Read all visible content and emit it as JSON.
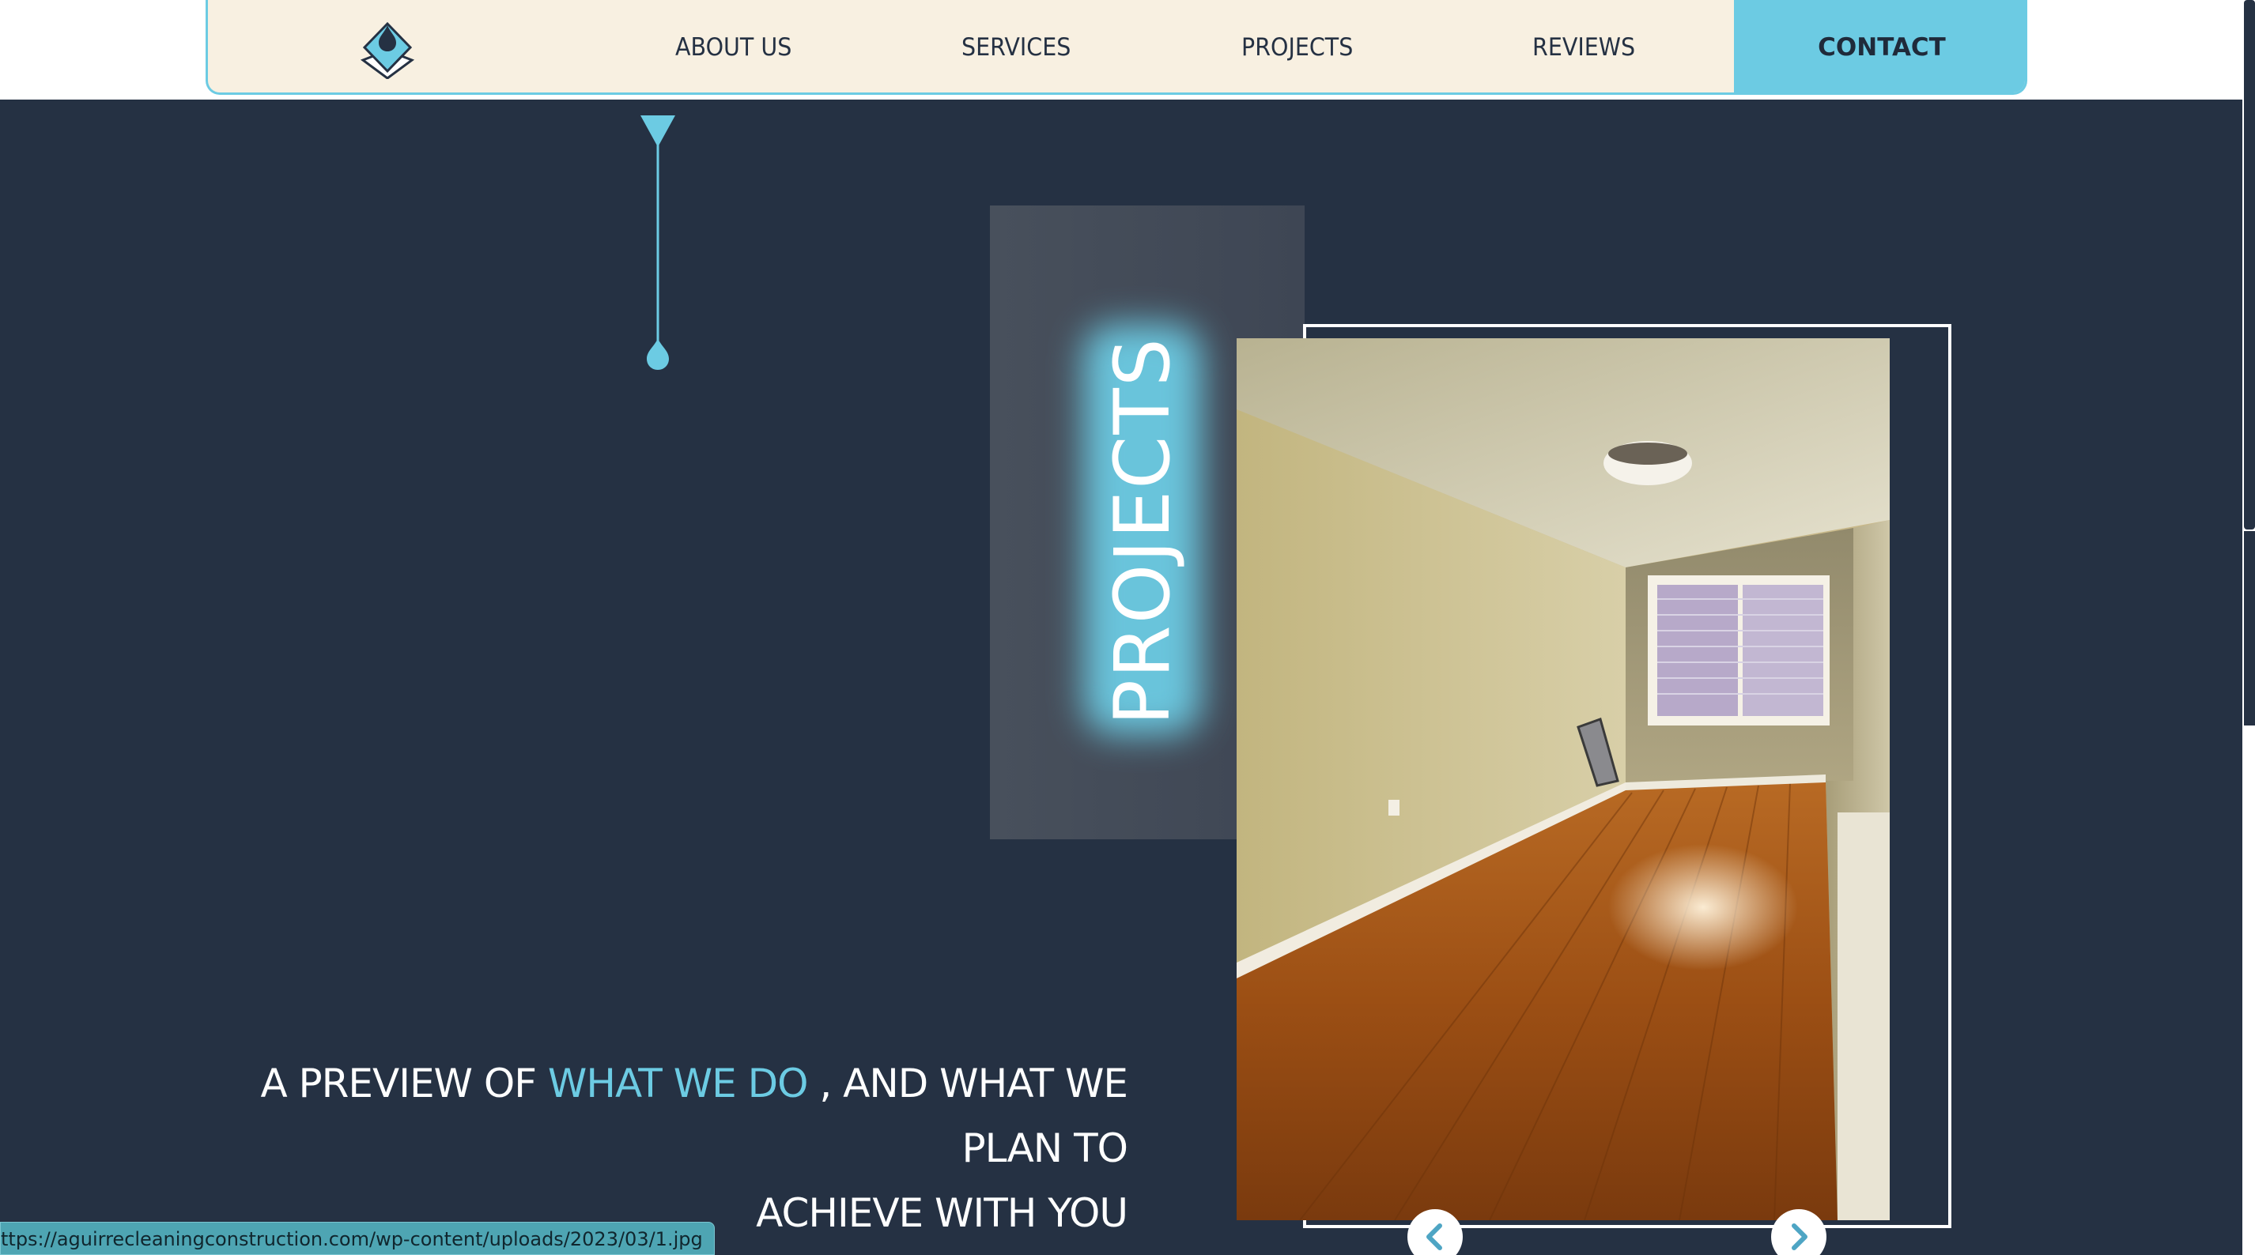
{
  "nav": {
    "items": [
      {
        "label": "ABOUT US"
      },
      {
        "label": "SERVICES"
      },
      {
        "label": "PROJECTS"
      },
      {
        "label": "REVIEWS"
      }
    ],
    "contact_label": "CONTACT"
  },
  "hero": {
    "vertical_title": "PROJECTS",
    "tagline_part1": "A PREVIEW OF ",
    "tagline_accent": "WHAT WE DO",
    "tagline_part2": " , AND WHAT WE PLAN TO",
    "tagline_line2": "ACHIEVE WITH YOU"
  },
  "slider": {
    "prev_icon": "chevron-left-icon",
    "next_icon": "chevron-right-icon"
  },
  "status_bar": {
    "url": "ttps://aguirrecleaningconstruction.com/wp-content/uploads/2023/03/1.jpg"
  },
  "colors": {
    "dark_bg": "#253143",
    "accent": "#6ccbe3",
    "nav_bg": "#f8f0e1"
  }
}
